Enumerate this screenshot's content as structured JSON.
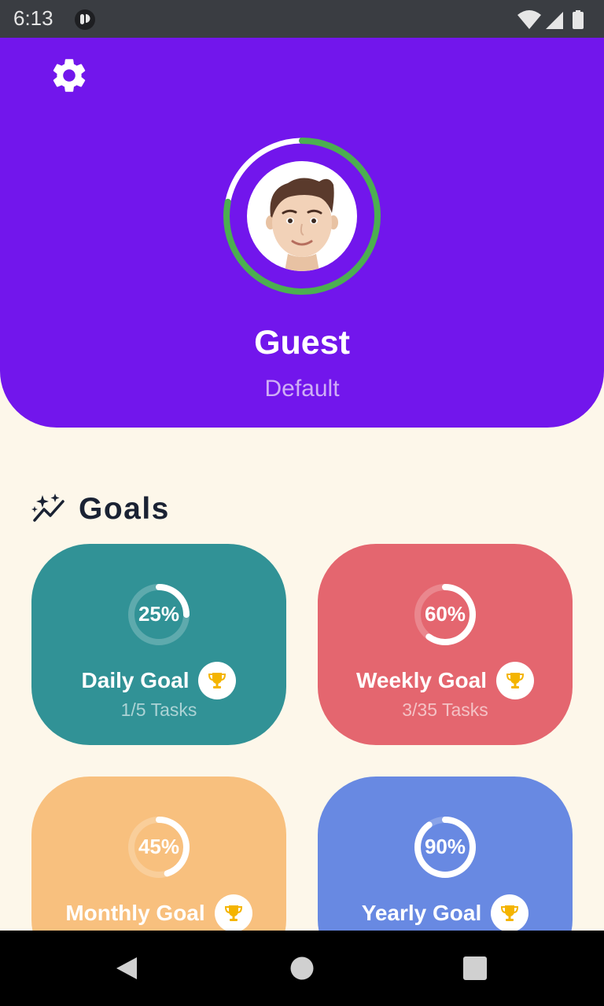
{
  "status_bar": {
    "time": "6:13",
    "icons": [
      "app-notification-icon",
      "wifi-icon",
      "signal-icon",
      "battery-icon"
    ]
  },
  "header": {
    "settings_icon": "gear-icon",
    "user_name": "Guest",
    "user_subtitle": "Default",
    "profile_progress": 0.78,
    "colors": {
      "background": "#7216EC",
      "ring_progress": "#4CAF50",
      "ring_track": "#FFFFFF"
    }
  },
  "goals": {
    "title": "Goals",
    "icon": "sparkles-trend-icon",
    "cards": [
      {
        "label": "Daily Goal",
        "percent": 25,
        "percent_text": "25%",
        "tasks": "1/5 Tasks",
        "color": "#319296",
        "trophy_icon": "trophy-icon"
      },
      {
        "label": "Weekly Goal",
        "percent": 60,
        "percent_text": "60%",
        "tasks": "3/35 Tasks",
        "color": "#E4666F",
        "trophy_icon": "trophy-icon"
      },
      {
        "label": "Monthly Goal",
        "percent": 45,
        "percent_text": "45%",
        "tasks": "",
        "color": "#F8C07E",
        "trophy_icon": "trophy-icon"
      },
      {
        "label": "Yearly Goal",
        "percent": 90,
        "percent_text": "90%",
        "tasks": "",
        "color": "#6889E2",
        "trophy_icon": "trophy-icon"
      }
    ]
  },
  "nav_bar": {
    "icons": [
      "back-icon",
      "home-icon",
      "recents-icon"
    ]
  }
}
